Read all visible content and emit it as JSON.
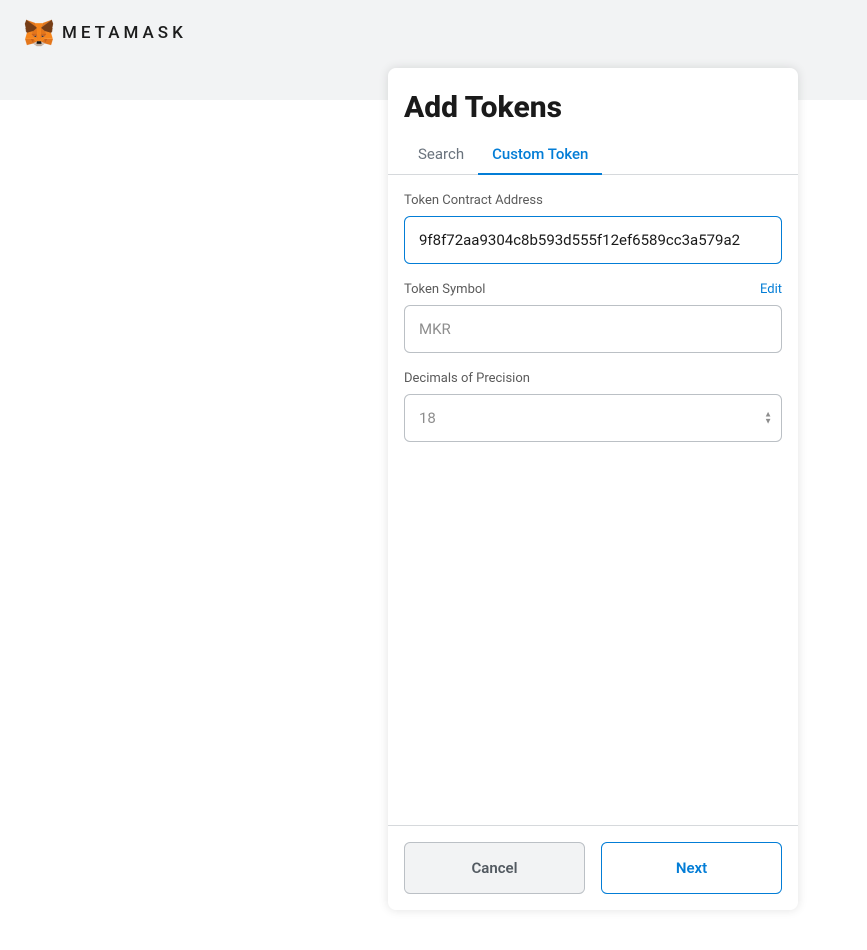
{
  "brand": "METAMASK",
  "modal": {
    "title": "Add Tokens",
    "tabs": {
      "search": "Search",
      "custom": "Custom Token"
    },
    "fields": {
      "contract": {
        "label": "Token Contract Address",
        "value": "9f8f72aa9304c8b593d555f12ef6589cc3a579a2"
      },
      "symbol": {
        "label": "Token Symbol",
        "edit": "Edit",
        "value": "MKR"
      },
      "decimals": {
        "label": "Decimals of Precision",
        "value": "18"
      }
    },
    "buttons": {
      "cancel": "Cancel",
      "next": "Next"
    }
  }
}
